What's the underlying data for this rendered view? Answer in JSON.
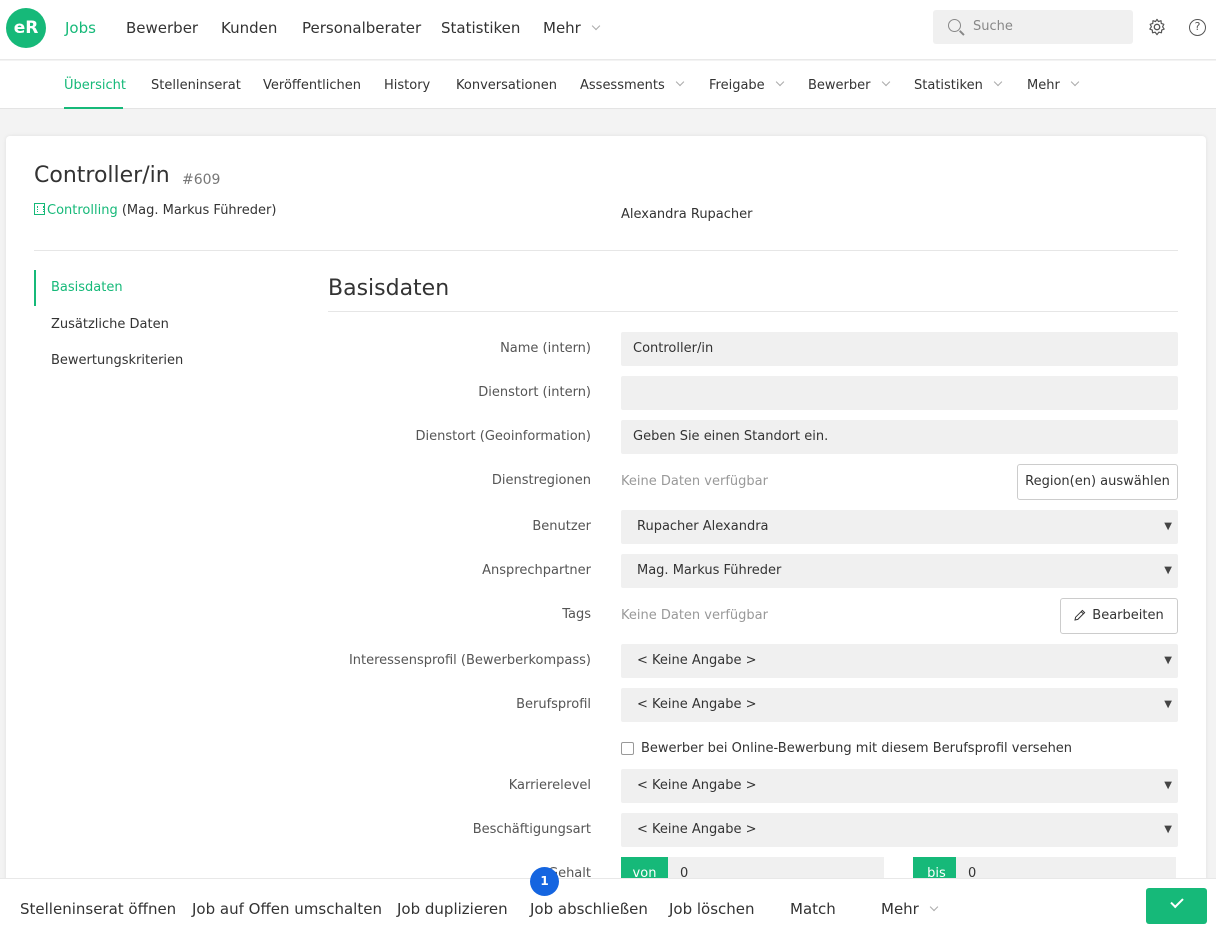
{
  "colors": {
    "accent": "#16b979",
    "badge": "#1565e0"
  },
  "app": {
    "logo_text": "eR"
  },
  "topnav": {
    "items": [
      "Jobs",
      "Bewerber",
      "Kunden",
      "Personalberater",
      "Statistiken",
      "Mehr"
    ],
    "search_placeholder": "Suche",
    "icons": [
      "search-icon",
      "gear-icon",
      "help-icon"
    ]
  },
  "subnav": {
    "items": [
      "Übersicht",
      "Stelleninserat",
      "Veröffentlichen",
      "History",
      "Konversationen",
      "Assessments",
      "Freigabe",
      "Bewerber",
      "Statistiken",
      "Mehr"
    ]
  },
  "job": {
    "title": "Controller/in",
    "id": "#609",
    "department": "Controlling",
    "contact": "(Mag. Markus Führeder)",
    "owner": "Alexandra Rupacher"
  },
  "side_menu": [
    "Basisdaten",
    "Zusätzliche Daten",
    "Bewertungskriterien"
  ],
  "section": {
    "title": "Basisdaten"
  },
  "form": {
    "name_label": "Name (intern)",
    "name_value": "Controller/in",
    "dienstort_label": "Dienstort (intern)",
    "dienstort_value": "",
    "geo_label": "Dienstort (Geoinformation)",
    "geo_placeholder": "Geben Sie einen Standort ein.",
    "regionen_label": "Dienstregionen",
    "regionen_value": "Keine Daten verfügbar",
    "regionen_button": "Region(en) auswählen",
    "benutzer_label": "Benutzer",
    "benutzer_value": "Rupacher Alexandra",
    "ansprech_label": "Ansprechpartner",
    "ansprech_value": "Mag. Markus Führeder",
    "tags_label": "Tags",
    "tags_value": "Keine Daten verfügbar",
    "tags_button": "Bearbeiten",
    "interessen_label": "Interessensprofil (Bewerberkompass)",
    "interessen_value": "< Keine Angabe >",
    "beruf_label": "Berufsprofil",
    "beruf_value": "< Keine Angabe >",
    "checkbox_label": "Bewerber bei Online-Bewerbung mit diesem Berufsprofil versehen",
    "karriere_label": "Karrierelevel",
    "karriere_value": "< Keine Angabe >",
    "beschaeftigung_label": "Beschäftigungsart",
    "beschaeftigung_value": "< Keine Angabe >",
    "gehalt_label": "Gehalt",
    "von_label": "von",
    "von_value": "0",
    "bis_label": "bis",
    "bis_value": "0"
  },
  "actions": {
    "items": [
      "Stelleninserat öffnen",
      "Job auf Offen umschalten",
      "Job duplizieren",
      "Job abschließen",
      "Job löschen",
      "Match",
      "Mehr"
    ],
    "badge": "1"
  }
}
